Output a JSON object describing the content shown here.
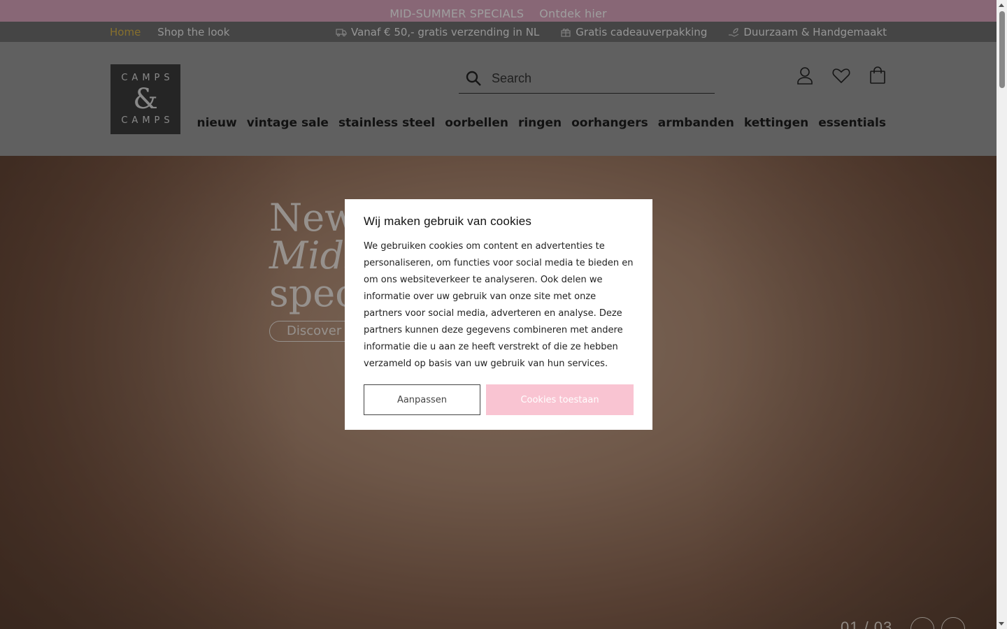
{
  "promo": {
    "title": "MID-SUMMER SPECIALS",
    "link": "Ontdek hier"
  },
  "utility": {
    "nav": [
      {
        "label": "Home",
        "active": true
      },
      {
        "label": "Shop the look",
        "active": false
      }
    ],
    "usps": [
      {
        "icon": "truck-icon",
        "label": "Vanaf € 50,- gratis verzending in NL"
      },
      {
        "icon": "gift-icon",
        "label": "Gratis cadeauverpakking"
      },
      {
        "icon": "hand-leaf-icon",
        "label": "Duurzaam & Handgemaakt"
      }
    ]
  },
  "logo": {
    "line1": "CAMPS",
    "line2": "&",
    "line3": "CAMPS"
  },
  "search": {
    "placeholder": "Search"
  },
  "header_icons": [
    "account-icon",
    "wishlist-heart-icon",
    "cart-bag-icon"
  ],
  "main_nav": [
    "nieuw",
    "vintage sale",
    "stainless steel",
    "oorbellen",
    "ringen",
    "oorhangers",
    "armbanden",
    "kettingen",
    "essentials"
  ],
  "hero": {
    "title_line1": "New",
    "title_line2": "Mids",
    "title_line3": "spec",
    "button": "Discover n",
    "counter": "01 / 03"
  },
  "cookie": {
    "title": "Wij maken gebruik van cookies",
    "body": "We gebruiken cookies om content en advertenties te personaliseren, om functies voor social media te bieden en om ons websiteverkeer te analyseren. Ook delen we informatie over uw gebruik van onze site met onze partners voor social media, adverteren en analyse. Deze partners kunnen deze gegevens combineren met andere informatie die u aan ze heeft verstrekt of die ze hebben verzameld op basis van uw gebruik van hun services.",
    "adjust_label": "Aanpassen",
    "accept_label": "Cookies toestaan"
  },
  "colors": {
    "promo_bg": "#dca7bf",
    "accent_gold": "#d9b44a",
    "accept_pink": "#f9c4d2"
  }
}
